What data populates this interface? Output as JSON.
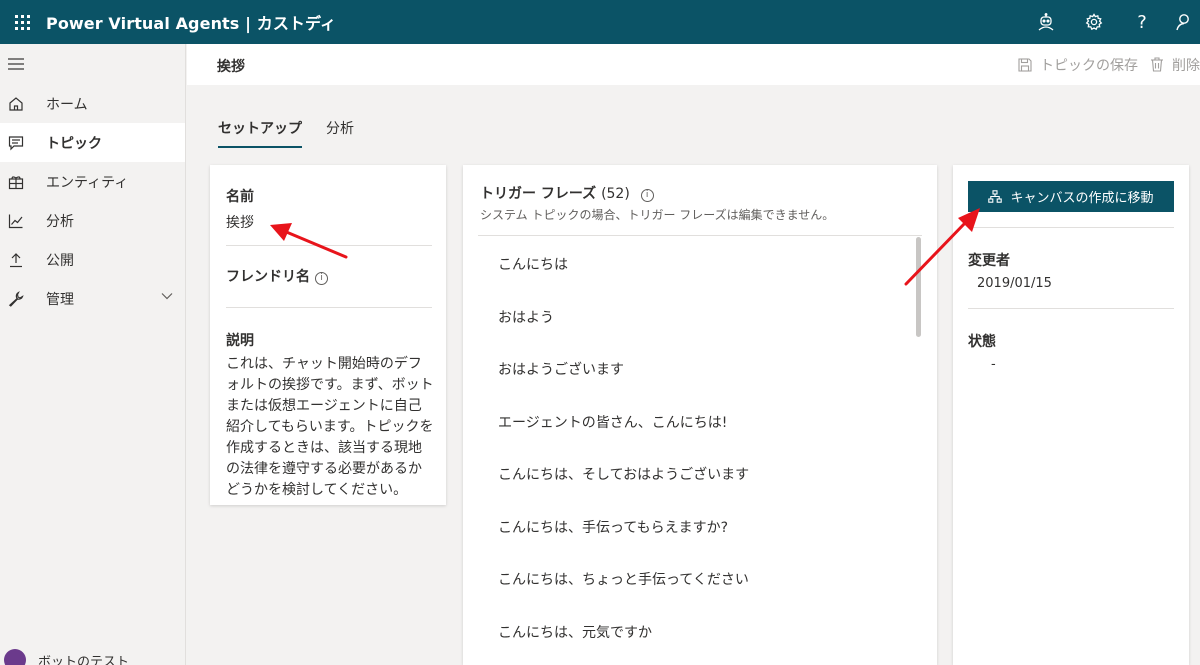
{
  "app": {
    "title": "Power Virtual Agents | カストディ"
  },
  "topbar": {
    "icons": [
      "bot-icon",
      "gear-icon",
      "help-icon",
      "person-icon"
    ],
    "help_label": "?"
  },
  "sidebar": {
    "items": [
      {
        "label": "ホーム",
        "icon": "home-icon"
      },
      {
        "label": "トピック",
        "icon": "chat-icon",
        "active": true
      },
      {
        "label": "エンティティ",
        "icon": "entity-icon"
      },
      {
        "label": "分析",
        "icon": "analytics-icon"
      },
      {
        "label": "公開",
        "icon": "upload-icon"
      },
      {
        "label": "管理",
        "icon": "wrench-icon"
      }
    ],
    "bottom_label": "ボットのテスト"
  },
  "command_bar": {
    "topic_name": "挨拶",
    "save_label": "トピックの保存",
    "delete_label": "削除"
  },
  "tabs": [
    {
      "label": "セットアップ",
      "active": true
    },
    {
      "label": "分析"
    }
  ],
  "details": {
    "name_label": "名前",
    "name_value": "挨拶",
    "friendly_label": "フレンドリ名",
    "info_glyph": "i",
    "desc_label": "説明",
    "desc_value": "これは、チャット開始時のデフォルトの挨拶です。まず、ボットまたは仮想エージェントに自己紹介してもらいます。トピックを作成するときは、該当する現地の法律を遵守する必要があるかどうかを検討してください。"
  },
  "triggers": {
    "title": "トリガー フレーズ",
    "count": "(52)",
    "subtitle": "システム トピックの場合、トリガー フレーズは編集できません。",
    "phrases": [
      "こんにちは",
      "おはよう",
      "おはようございます",
      "エージェントの皆さん、こんにちは!",
      "こんにちは、そしておはようございます",
      "こんにちは、手伝ってもらえますか?",
      "こんにちは、ちょっと手伝ってください",
      "こんにちは、元気ですか"
    ]
  },
  "meta": {
    "canvas_button": "キャンバスの作成に移動",
    "changed_by_label": "変更者",
    "changed_by_value": "2019/01/15",
    "status_label": "状態",
    "status_value": "-"
  },
  "annotation_color": "#e8141b",
  "theme": {
    "primary": "#0b5366"
  }
}
